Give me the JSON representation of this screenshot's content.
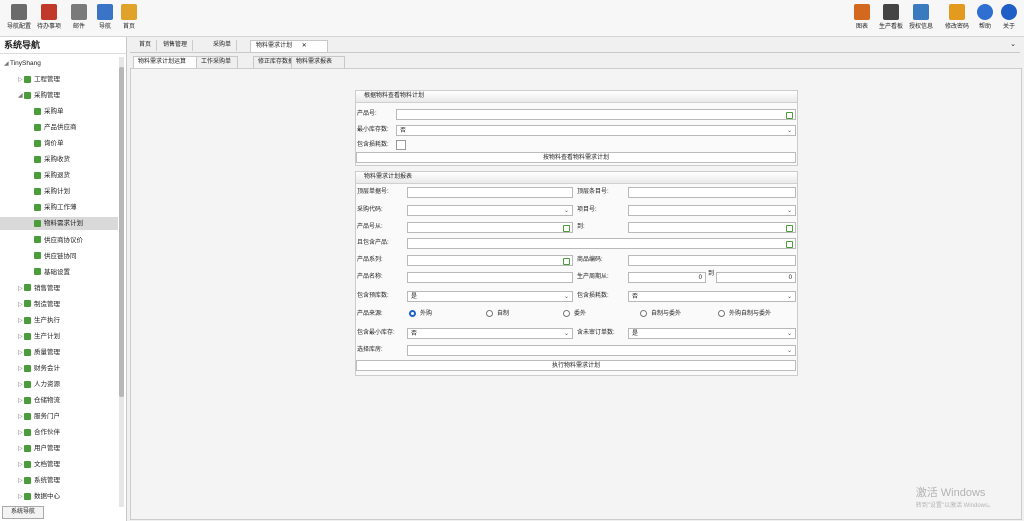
{
  "toolbar": {
    "left": [
      {
        "label": "导航配置",
        "icon": "users-gear-icon",
        "color": "#6b6b6b"
      },
      {
        "label": "待办事项",
        "icon": "calendar-icon",
        "color": "#c0392b"
      },
      {
        "label": "邮件",
        "icon": "mail-icon",
        "color": "#7a7a7a"
      },
      {
        "label": "导航",
        "icon": "navigate-icon",
        "color": "#3b74c7"
      },
      {
        "label": "首页",
        "icon": "home-icon",
        "color": "#e0a22a"
      }
    ],
    "right": [
      {
        "label": "图表",
        "icon": "bar-chart-icon",
        "color": "#d2691e"
      },
      {
        "label": "生产看板",
        "icon": "monitor-icon",
        "color": "#444"
      },
      {
        "label": "授权信息",
        "icon": "license-icon",
        "color": "#3a7bbf"
      },
      {
        "label": "修改密码",
        "icon": "key-icon",
        "color": "#e39b1f"
      },
      {
        "label": "帮助",
        "icon": "help-icon",
        "color": "#2e6fd1"
      },
      {
        "label": "关于",
        "icon": "info-icon",
        "color": "#1f5fc5"
      }
    ]
  },
  "nav": {
    "title": "系统导航",
    "footer": "系统导航",
    "root": "TinyShang",
    "items": [
      {
        "label": "工程管理",
        "level": 1,
        "expander": "▷"
      },
      {
        "label": "采购管理",
        "level": 1,
        "expander": "◢"
      },
      {
        "label": "采购单",
        "level": 2
      },
      {
        "label": "产品供应商",
        "level": 2
      },
      {
        "label": "询价单",
        "level": 2
      },
      {
        "label": "采购收货",
        "level": 2
      },
      {
        "label": "采购退货",
        "level": 2
      },
      {
        "label": "采购计划",
        "level": 2
      },
      {
        "label": "采购工作薄",
        "level": 2
      },
      {
        "label": "物料需求计划",
        "level": 2,
        "selected": true
      },
      {
        "label": "供应商协议价",
        "level": 2
      },
      {
        "label": "供应链协同",
        "level": 2
      },
      {
        "label": "基础设置",
        "level": 2
      },
      {
        "label": "销售管理",
        "level": 1,
        "expander": "▷"
      },
      {
        "label": "制造管理",
        "level": 1,
        "expander": "▷"
      },
      {
        "label": "生产执行",
        "level": 1,
        "expander": "▷"
      },
      {
        "label": "生产计划",
        "level": 1,
        "expander": "▷"
      },
      {
        "label": "质量管理",
        "level": 1,
        "expander": "▷"
      },
      {
        "label": "财务会计",
        "level": 1,
        "expander": "▷"
      },
      {
        "label": "人力资源",
        "level": 1,
        "expander": "▷"
      },
      {
        "label": "仓储物流",
        "level": 1,
        "expander": "▷"
      },
      {
        "label": "服务门户",
        "level": 1,
        "expander": "▷"
      },
      {
        "label": "合作伙伴",
        "level": 1,
        "expander": "▷"
      },
      {
        "label": "用户管理",
        "level": 1,
        "expander": "▷"
      },
      {
        "label": "文档管理",
        "level": 1,
        "expander": "▷"
      },
      {
        "label": "系统管理",
        "level": 1,
        "expander": "▷"
      },
      {
        "label": "数据中心",
        "level": 1,
        "expander": "▷"
      }
    ]
  },
  "doctabs": [
    "首页",
    "销售管理",
    "采购单",
    "物料需求计划"
  ],
  "doctab_close": "✕",
  "subtabs": [
    "物料需求计划运算",
    "工作采购单",
    "修正库存数据",
    "物料需求报表"
  ],
  "g1": {
    "title": "根据物料查看物料计划",
    "product_label": "产品号:",
    "minstock_label": "最小库存数:",
    "minstock_value": "否",
    "loss_label": "包含损耗数:",
    "button": "按物料查看物料需求计划"
  },
  "g2": {
    "title": "物料需求计划报表",
    "l_top_order": "顶层单据号:",
    "l_top_item": "顶层条目号:",
    "l_purchase_code": "采购代码:",
    "l_project": "项目号:",
    "l_product_from": "产品号从:",
    "l_to": "到:",
    "l_included": "且包含产品:",
    "l_series": "产品系列:",
    "l_product_code": "商品编码:",
    "l_product_name": "产品名称:",
    "l_cycle": "生产周期从:",
    "cycle_from": "0",
    "cycle_to_label": "到",
    "cycle_to": "0",
    "l_safe_stock": "包含预库数:",
    "safe_stock_value": "是",
    "l_loss": "包含损耗数:",
    "loss_value": "否",
    "l_source": "产品来源:",
    "sources": [
      "外购",
      "自制",
      "委外",
      "自制与委外",
      "外购自制与委外"
    ],
    "l_min_stock": "包含最小库存:",
    "min_stock_value": "否",
    "l_unreviewed": "含未审订单数:",
    "unreviewed_value": "是",
    "l_warehouse": "选择库房:",
    "button": "执行物料需求计划"
  },
  "watermark": {
    "line1": "激活 Windows",
    "line2": "转到\"设置\"以激活 Windows。"
  }
}
